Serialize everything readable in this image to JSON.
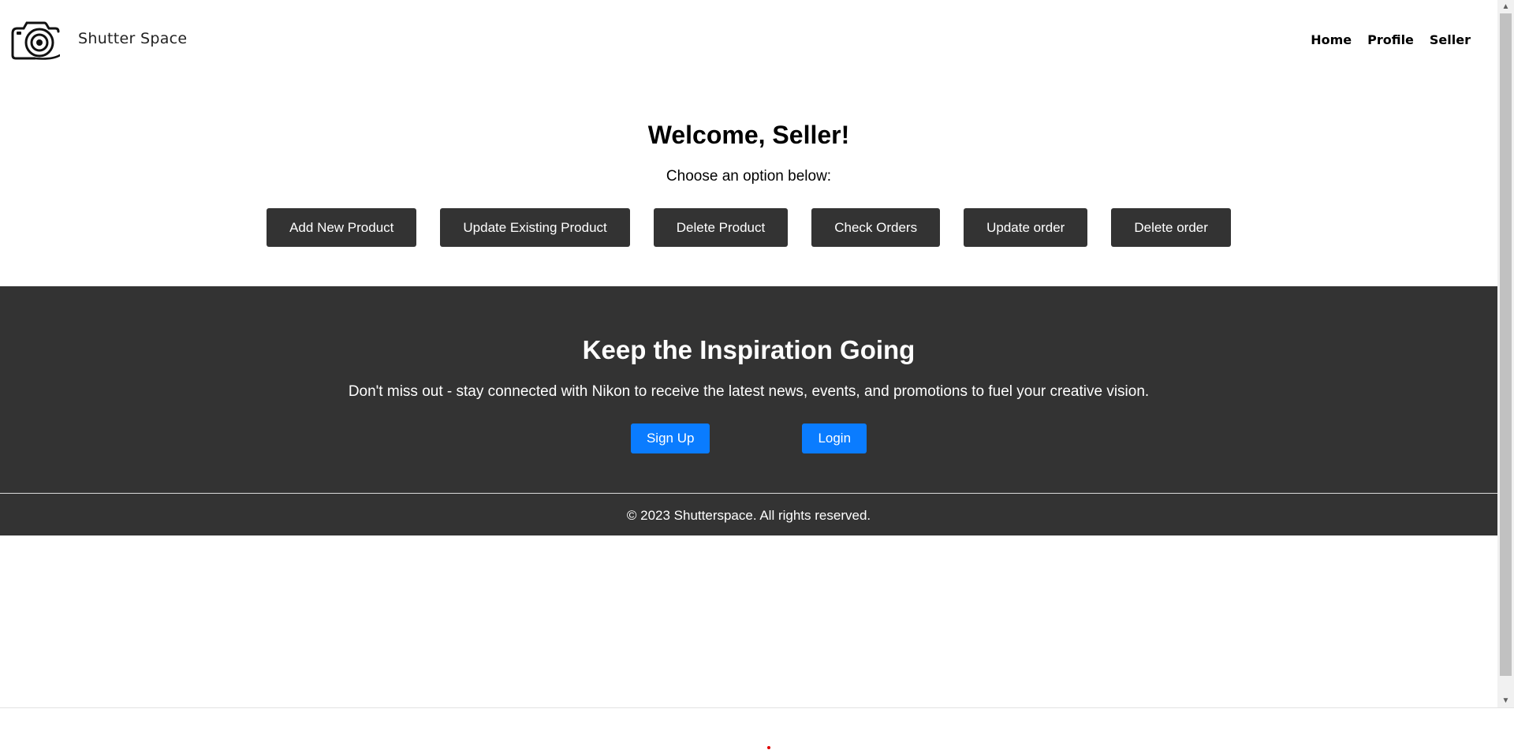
{
  "header": {
    "brand": "Shutter Space",
    "logo_icon": "camera-icon",
    "nav": [
      {
        "label": "Home"
      },
      {
        "label": "Profile"
      },
      {
        "label": "Seller"
      }
    ]
  },
  "seller": {
    "title": "Welcome, Seller!",
    "subtitle": "Choose an option below:",
    "actions": [
      {
        "label": "Add New Product"
      },
      {
        "label": "Update Existing Product"
      },
      {
        "label": "Delete Product"
      },
      {
        "label": "Check Orders"
      },
      {
        "label": "Update order"
      },
      {
        "label": "Delete order"
      }
    ]
  },
  "inspiration": {
    "title": "Keep the Inspiration Going",
    "text": "Don't miss out - stay connected with Nikon to receive the latest news, events, and promotions to fuel your creative vision.",
    "signup_label": "Sign Up",
    "login_label": "Login"
  },
  "footer": {
    "copyright": "© 2023 Shutterspace. All rights reserved."
  },
  "colors": {
    "dark": "#333333",
    "accent_blue": "#0a7cff",
    "white": "#ffffff"
  }
}
